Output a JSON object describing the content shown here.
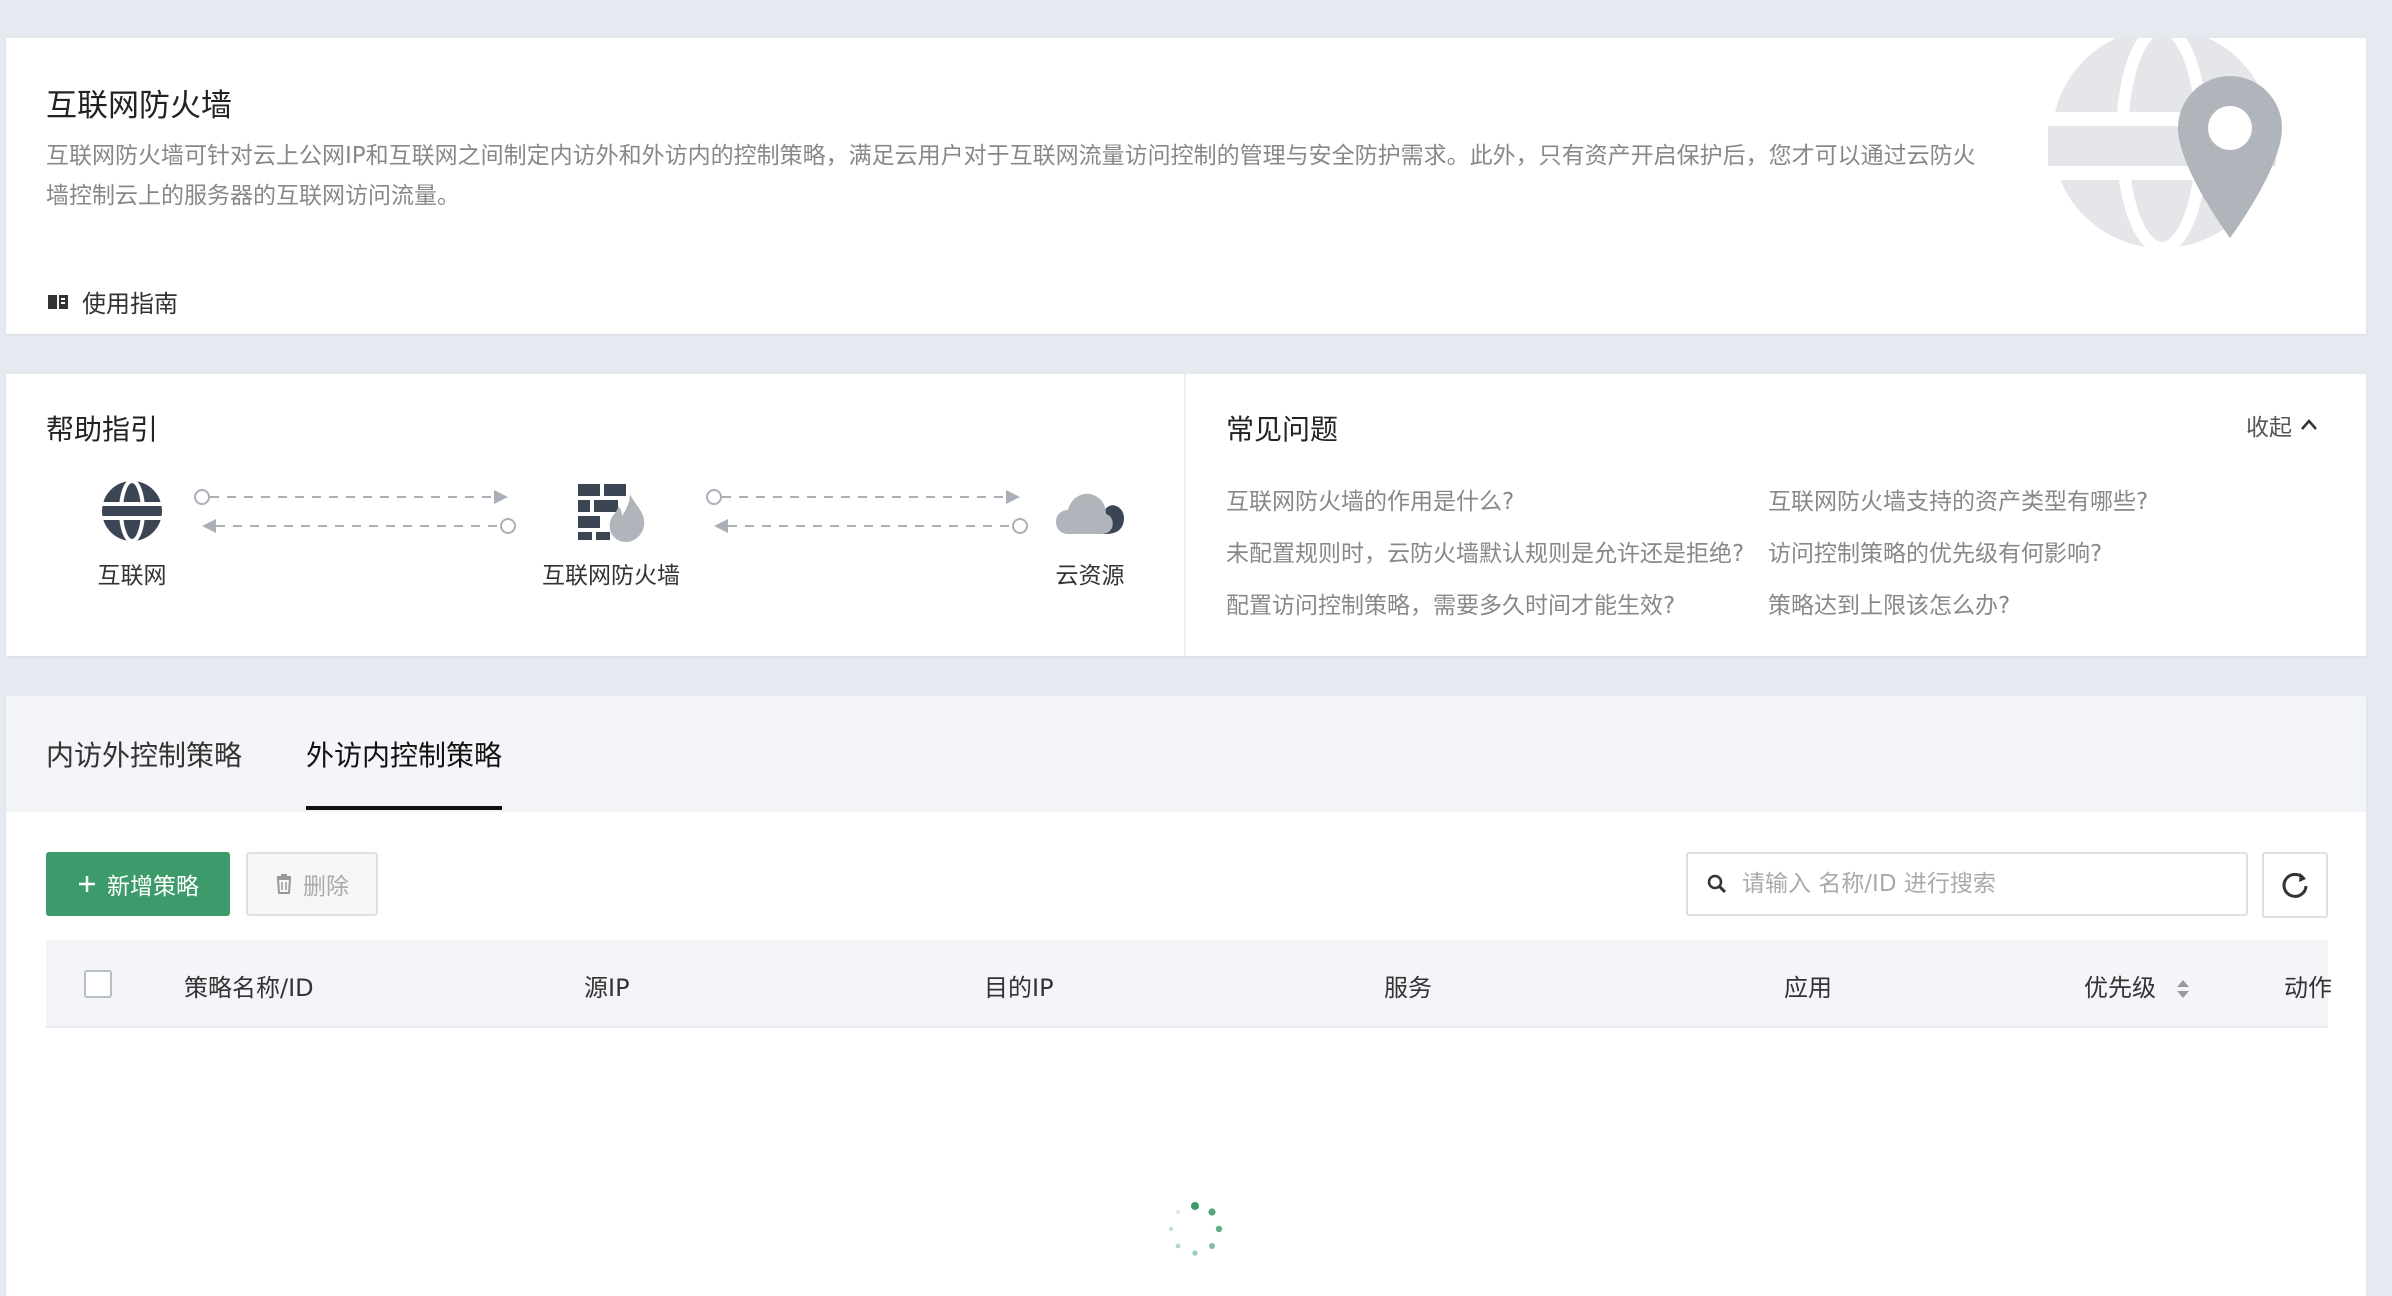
{
  "intro": {
    "title": "互联网防火墙",
    "description": "互联网防火墙可针对云上公网IP和互联网之间制定内访外和外访内的控制策略，满足云用户对于互联网流量访问控制的管理与安全防护需求。此外，只有资产开启保护后，您才可以通过云防火墙控制云上的服务器的互联网访问流量。",
    "guide_link": "使用指南"
  },
  "help": {
    "title": "帮助指引",
    "flow": {
      "internet": "互联网",
      "firewall": "互联网防火墙",
      "cloud": "云资源"
    }
  },
  "faq": {
    "title": "常见问题",
    "collapse": "收起",
    "items": [
      "互联网防火墙的作用是什么?",
      "互联网防火墙支持的资产类型有哪些?",
      "未配置规则时，云防火墙默认规则是允许还是拒绝?",
      "访问控制策略的优先级有何影响?",
      "配置访问控制策略，需要多久时间才能生效?",
      "策略达到上限该怎么办?"
    ]
  },
  "tabs": [
    "内访外控制策略",
    "外访内控制策略"
  ],
  "toolbar": {
    "add_label": "新增策略",
    "delete_label": "删除",
    "search_placeholder": "请输入 名称/ID 进行搜索"
  },
  "table": {
    "columns": [
      "策略名称/ID",
      "源IP",
      "目的IP",
      "服务",
      "应用",
      "优先级",
      "动作"
    ]
  },
  "colors": {
    "primary": "#3d9b6b",
    "page_bg": "#e5e9f0",
    "text_muted": "#888888"
  }
}
